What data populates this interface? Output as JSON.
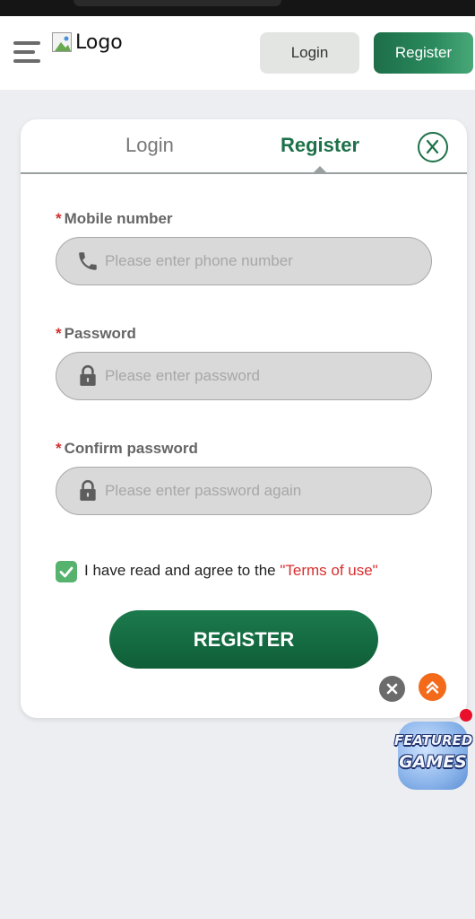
{
  "header": {
    "logo_alt": "Logo",
    "login_label": "Login",
    "register_label": "Register"
  },
  "modal": {
    "tabs": [
      {
        "label": "Login",
        "active": false
      },
      {
        "label": "Register",
        "active": true
      }
    ],
    "fields": [
      {
        "required_mark": "*",
        "label": "Mobile number",
        "placeholder": "Please enter phone number",
        "icon": "phone-icon"
      },
      {
        "required_mark": "*",
        "label": "Password",
        "placeholder": "Please enter password",
        "icon": "lock-icon"
      },
      {
        "required_mark": "*",
        "label": "Confirm password",
        "placeholder": "Please enter password again",
        "icon": "lock-icon"
      }
    ],
    "agree": {
      "checked": true,
      "text": "I have read and agree to the ",
      "terms_text": "\"Terms of use\""
    },
    "submit_label": "REGISTER"
  },
  "floating": {
    "badge_line1": "FEATURED",
    "badge_line2": "GAMES"
  },
  "colors": {
    "brand_green": "#1d7148",
    "terms_red": "#d92e2e",
    "required_red": "#d23030",
    "scroll_top_orange": "#f26a1a"
  }
}
